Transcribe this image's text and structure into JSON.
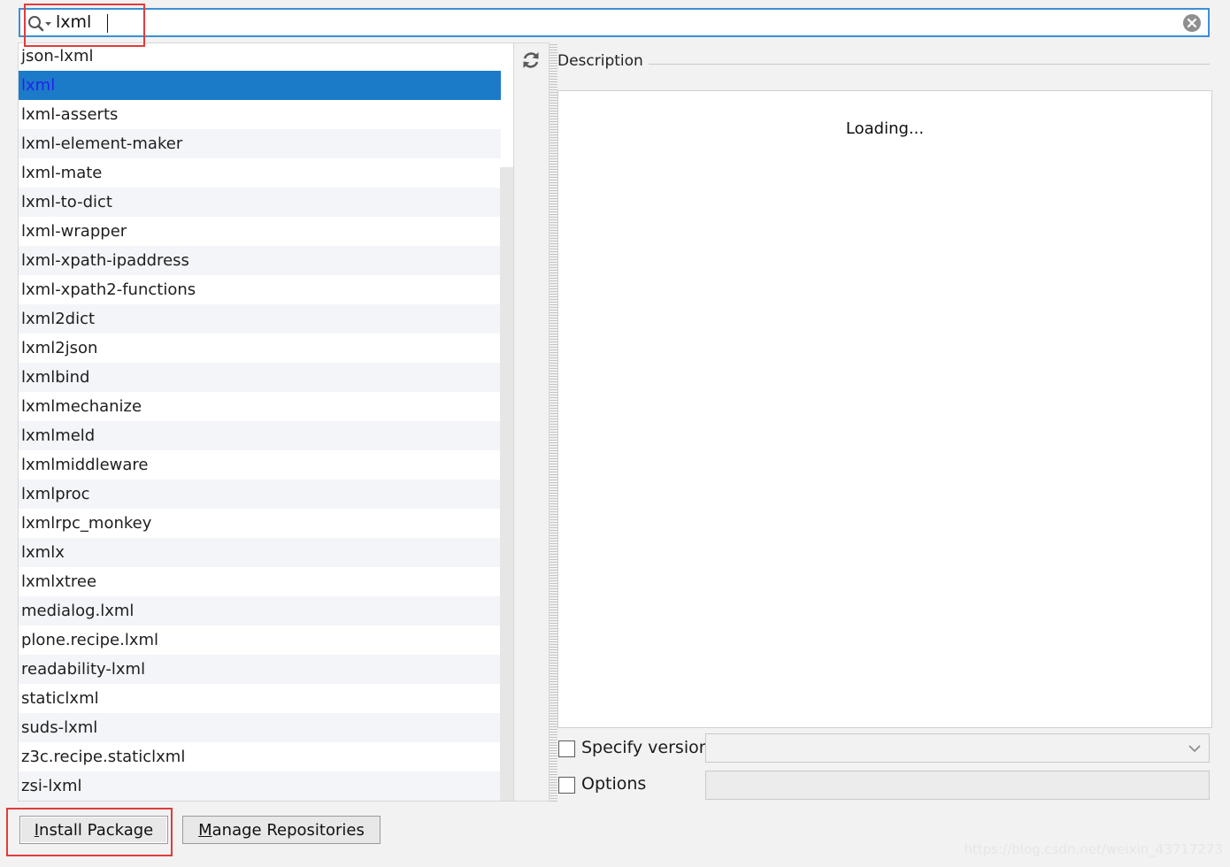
{
  "search": {
    "value": "lxml"
  },
  "packages": [
    "json-lxml",
    "lxml",
    "lxml-asserts",
    "lxml-element-maker",
    "lxml-mate",
    "lxml-to-dict",
    "lxml-wrapper",
    "lxml-xpath-ipaddress",
    "lxml-xpath2-functions",
    "lxml2dict",
    "lxml2json",
    "lxmlbind",
    "lxmlmechanize",
    "lxmlmeld",
    "lxmlmiddleware",
    "lxmlproc",
    "lxmlrpc_monkey",
    "lxmlx",
    "lxmlxtree",
    "medialog.lxml",
    "plone.recipe.lxml",
    "readability-lxml",
    "staticlxml",
    "suds-lxml",
    "z3c.recipe.staticlxml",
    "zsi-lxml"
  ],
  "selected_index": 1,
  "description": {
    "label": "Description",
    "content": "Loading..."
  },
  "options": {
    "specify_version_label": "Specify version",
    "specify_version_checked": false,
    "version_value": "",
    "options_label": "Options",
    "options_checked": false,
    "options_value": ""
  },
  "buttons": {
    "install_mnemonic": "I",
    "install_rest": "nstall Package",
    "manage_mnemonic": "M",
    "manage_rest": "anage Repositories"
  },
  "watermark": "https://blog.csdn.net/weixin_43717273",
  "colors": {
    "selection": "#1c7bc8",
    "focus_border": "#3b8fd6",
    "highlight": "#e23b3b"
  }
}
